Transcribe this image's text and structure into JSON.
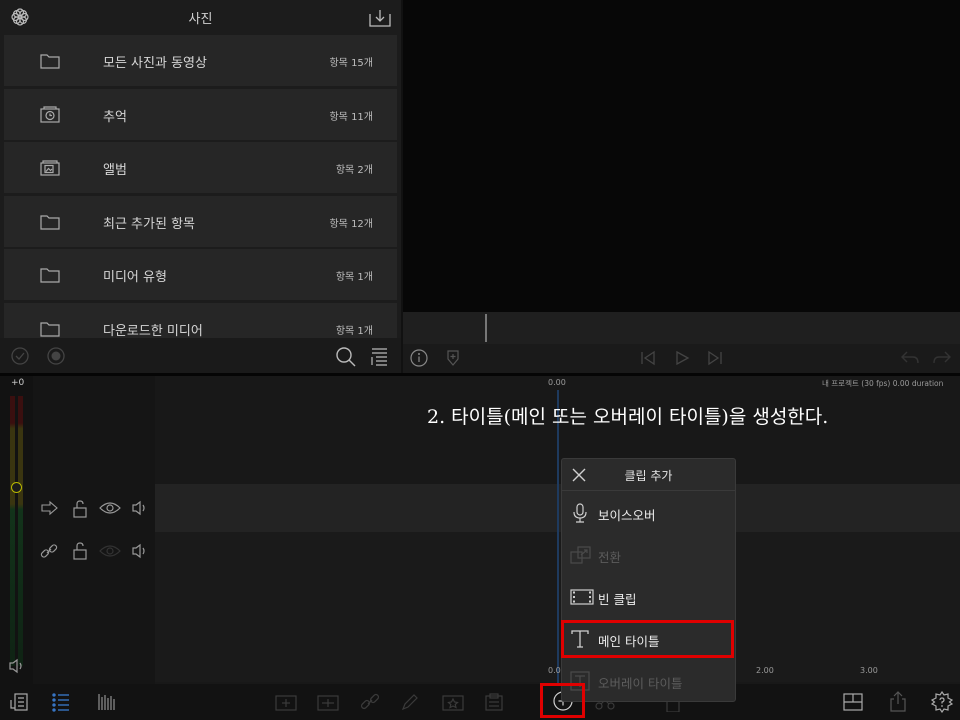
{
  "library": {
    "title": "사진",
    "items": [
      {
        "label": "모든 사진과 동영상",
        "count": "항목 15개",
        "icon": "folder-icon"
      },
      {
        "label": "추억",
        "count": "항목 11개",
        "icon": "memories-icon"
      },
      {
        "label": "앨범",
        "count": "항목 2개",
        "icon": "album-icon"
      },
      {
        "label": "최근 추가된 항목",
        "count": "항목 12개",
        "icon": "folder-icon"
      },
      {
        "label": "미디어 유형",
        "count": "항목 1개",
        "icon": "folder-icon"
      },
      {
        "label": "다운로드한 미디어",
        "count": "항목 1개",
        "icon": "folder-icon"
      }
    ]
  },
  "timeline": {
    "meter_label": "+0",
    "start_time": "0.00",
    "project_info": "내 프로젝트 (30 fps)  0.00 duration",
    "ruler_bottom": [
      "0.00",
      "2.00",
      "3.00"
    ]
  },
  "instruction": "2. 타이틀(메인 또는 오버레이 타이틀)을 생성한다.",
  "popup": {
    "title": "클립 추가",
    "items": [
      {
        "label": "보이스오버",
        "icon": "microphone-icon",
        "enabled": true
      },
      {
        "label": "전환",
        "icon": "transition-icon",
        "enabled": false
      },
      {
        "label": "빈 클립",
        "icon": "film-strip-icon",
        "enabled": true
      },
      {
        "label": "메인 타이틀",
        "icon": "title-t-icon",
        "enabled": true
      },
      {
        "label": "오버레이 타이틀",
        "icon": "overlay-title-icon",
        "enabled": false
      }
    ]
  },
  "colors": {
    "highlight": "#e00000",
    "background": "#111111",
    "playhead": "#1e3a5e"
  }
}
